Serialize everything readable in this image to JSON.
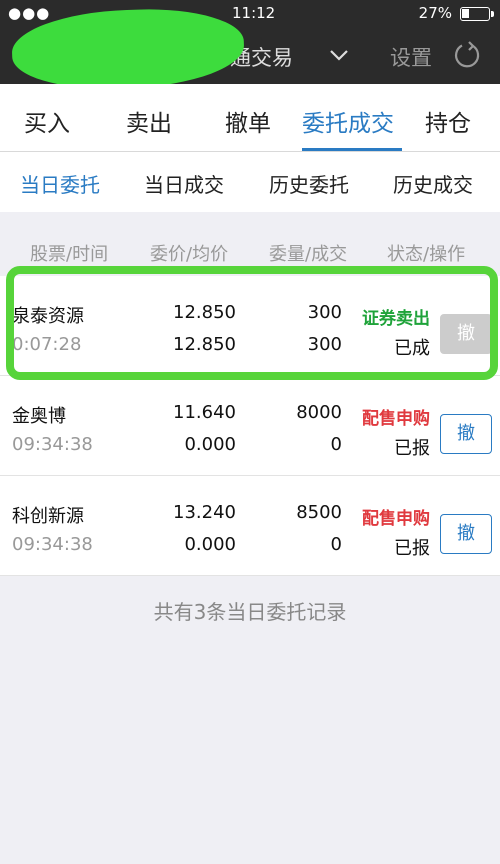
{
  "status_bar": {
    "signal": "●●●",
    "time": "11:12",
    "battery": "27%"
  },
  "header": {
    "title": "通交易",
    "settings_label": "设置"
  },
  "tabs": [
    {
      "label": "买入"
    },
    {
      "label": "卖出"
    },
    {
      "label": "撤单"
    },
    {
      "label": "委托成交"
    },
    {
      "label": "持仓"
    }
  ],
  "subtabs": [
    {
      "label": "当日委托"
    },
    {
      "label": "当日成交"
    },
    {
      "label": "历史委托"
    },
    {
      "label": "历史成交"
    }
  ],
  "columns": {
    "stock_time": "股票/时间",
    "price_avg": "委价/均价",
    "qty_filled": "委量/成交",
    "status_op": "状态/操作"
  },
  "orders": [
    {
      "name": "泉泰资源",
      "time": "0:07:28",
      "price": "12.850",
      "avg_price": "12.850",
      "quantity": "300",
      "filled": "300",
      "type": "证券卖出",
      "type_color": "#1fa33a",
      "status": "已成",
      "action": "撤"
    },
    {
      "name": "金奥博",
      "time": "09:34:38",
      "price": "11.640",
      "avg_price": "0.000",
      "quantity": "8000",
      "filled": "0",
      "type": "配售申购",
      "type_color": "#e0393e",
      "status": "已报",
      "action": "撤"
    },
    {
      "name": "科创新源",
      "time": "09:34:38",
      "price": "13.240",
      "avg_price": "0.000",
      "quantity": "8500",
      "filled": "0",
      "type": "配售申购",
      "type_color": "#e0393e",
      "status": "已报",
      "action": "撤"
    }
  ],
  "footer": {
    "summary": "共有3条当日委托记录"
  },
  "colors": {
    "accent": "#2a7bc3",
    "highlight": "#57d43a"
  }
}
